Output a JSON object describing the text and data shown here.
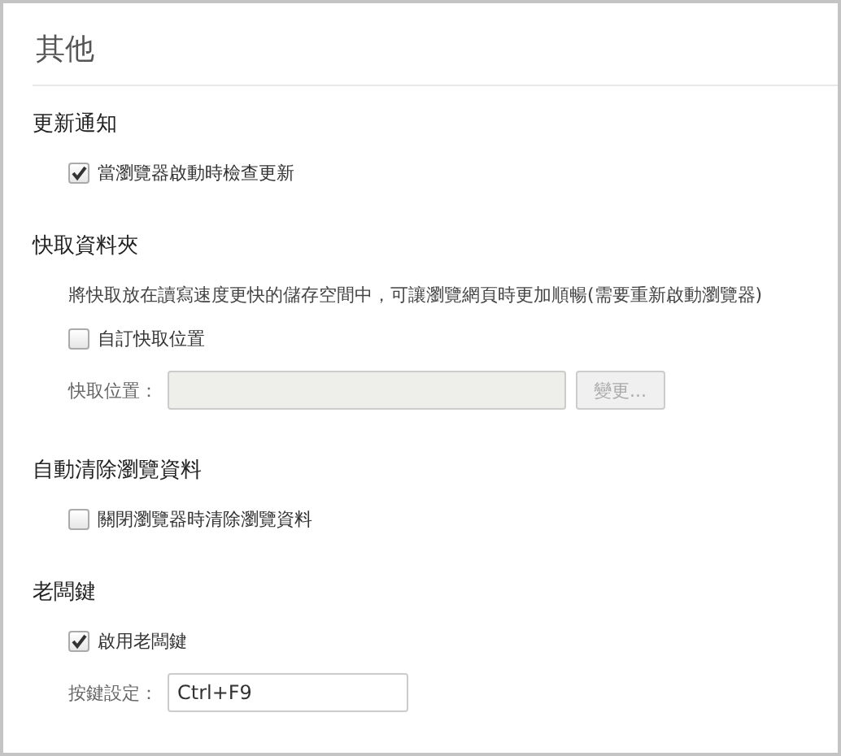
{
  "title": "其他",
  "sections": [
    {
      "heading": "更新通知",
      "items": [
        {
          "kind": "checkbox",
          "label": "當瀏覽器啟動時檢查更新",
          "checked": true
        }
      ]
    },
    {
      "heading": "快取資料夾",
      "items": [
        {
          "kind": "text",
          "text": "將快取放在讀寫速度更快的儲存空間中，可讓瀏覽網頁時更加順暢(需要重新啟動瀏覽器)"
        },
        {
          "kind": "checkbox",
          "label": "自訂快取位置",
          "checked": false
        },
        {
          "kind": "path",
          "label": "快取位置：",
          "button": "變更...",
          "disabled": true
        }
      ]
    },
    {
      "heading": "自動清除瀏覽資料",
      "items": [
        {
          "kind": "checkbox",
          "label": "關閉瀏覽器時清除瀏覽資料",
          "checked": false
        }
      ]
    },
    {
      "heading": "老闆鍵",
      "items": [
        {
          "kind": "checkbox",
          "label": "啟用老闆鍵",
          "checked": true
        },
        {
          "kind": "input",
          "label": "按鍵設定：",
          "value": "Ctrl+F9"
        }
      ]
    }
  ]
}
